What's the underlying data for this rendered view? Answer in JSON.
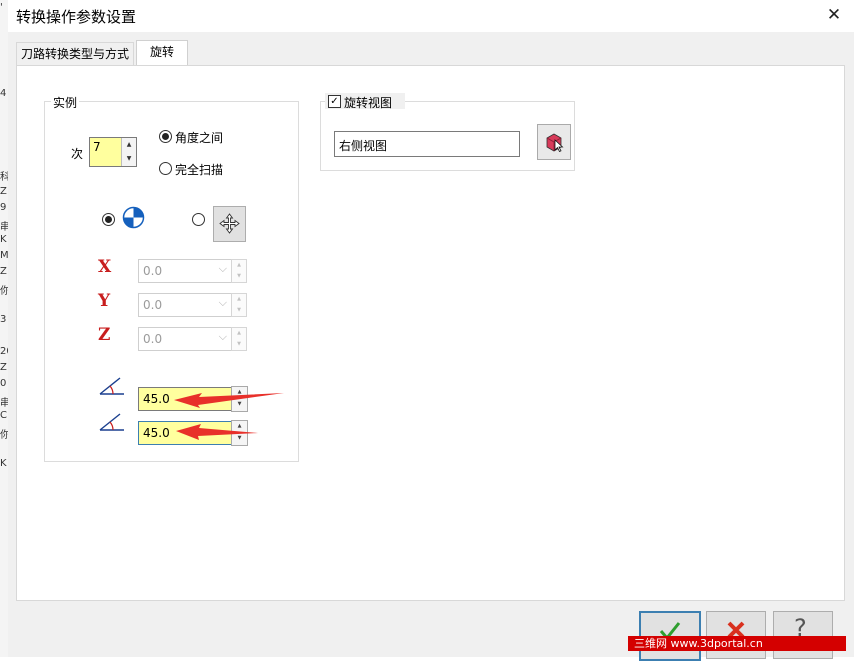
{
  "background_fragments": [
    "'",
    "4",
    "科",
    "Z",
    "9",
    "串",
    "K",
    "MC",
    "Z",
    "你",
    "3",
    "20",
    "Z",
    "0",
    "串",
    "C",
    "你",
    "K"
  ],
  "dialog": {
    "title": "转换操作参数设置",
    "close_glyph": "✕",
    "tabs": [
      {
        "label": "刀路转换类型与方式",
        "active": false
      },
      {
        "label": "旋转",
        "active": true
      }
    ]
  },
  "instance_group": {
    "legend": "实例",
    "count_label": "次",
    "count_value": "7",
    "mode_options": [
      {
        "label": "角度之间",
        "selected": true
      },
      {
        "label": "完全扫描",
        "selected": false
      }
    ],
    "center_options": [
      {
        "icon": "origin-icon",
        "selected": true
      },
      {
        "icon": "move-point-icon",
        "selected": false
      }
    ],
    "axes": [
      {
        "label": "X",
        "value": "0.0"
      },
      {
        "label": "Y",
        "value": "0.0"
      },
      {
        "label": "Z",
        "value": "0.0"
      }
    ],
    "angles": [
      {
        "icon": "start-angle-icon",
        "value": "45.0"
      },
      {
        "icon": "sweep-angle-icon",
        "value": "45.0"
      }
    ]
  },
  "rotate_view_group": {
    "checkbox_label": "旋转视图",
    "checked": true,
    "view_value": "右侧视图",
    "select_icon": "view-select-icon"
  },
  "footer": {
    "ok_icon": "check-icon",
    "cancel_icon": "cancel-x-icon",
    "help_icon": "help-icon",
    "help_glyph": "?",
    "watermark": "三维网 www.3dportal.cn"
  },
  "colors": {
    "highlight_field": "#ffff9e",
    "arrow": "#e8302a",
    "axis_letter": "#c81e1e",
    "ok_check": "#2f9e2f",
    "cancel_x": "#d9301e"
  }
}
